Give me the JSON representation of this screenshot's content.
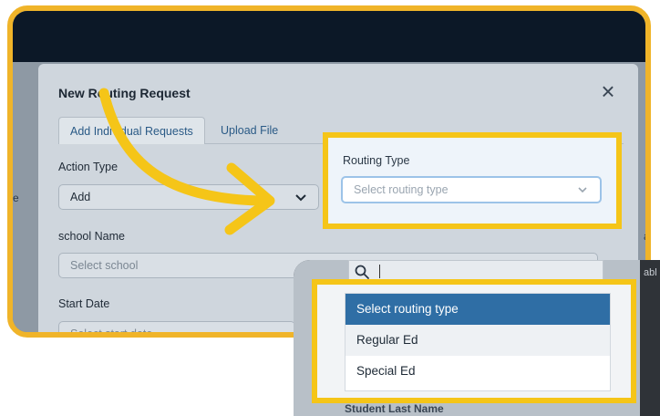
{
  "modal": {
    "title": "New Routing Request",
    "close_label": "×",
    "tabs": [
      {
        "label": "Add Individual Requests",
        "active": true
      },
      {
        "label": "Upload File",
        "active": false
      }
    ],
    "action_type": {
      "label": "Action Type",
      "value": "Add"
    },
    "routing_type": {
      "label": "Routing Type",
      "placeholder": "Select routing type"
    },
    "school_name": {
      "label": "school Name",
      "placeholder": "Select school"
    },
    "start_date": {
      "label": "Start Date",
      "placeholder": "Select start date"
    }
  },
  "background": {
    "left_fragment": "e",
    "right_fragment_1": "ab",
    "right_fragment_2": "abl"
  },
  "dropdown": {
    "options": [
      {
        "label": "Select routing type",
        "selected": true
      },
      {
        "label": "Regular Ed",
        "selected": false
      },
      {
        "label": "Special Ed",
        "selected": false
      }
    ],
    "partial_label": "Student Last Name"
  },
  "colors": {
    "highlight": "#f5c518",
    "frame": "#f0b429",
    "accent": "#2f6ea5",
    "topbar": "#0c1827"
  },
  "icons": [
    "close-icon",
    "chevron-down-icon",
    "search-icon",
    "curved-arrow-icon"
  ]
}
